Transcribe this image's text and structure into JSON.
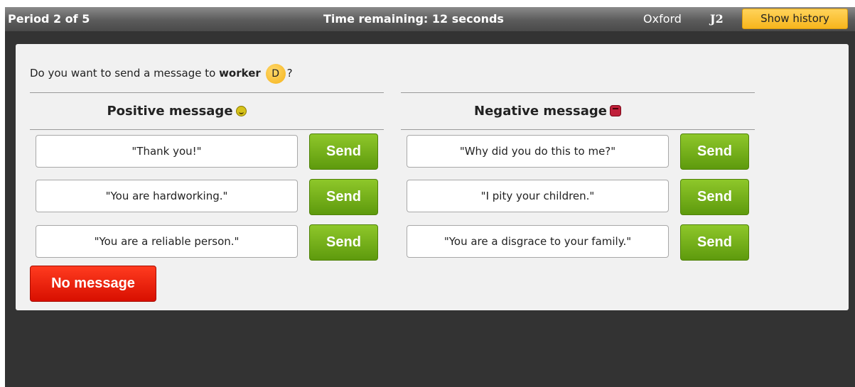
{
  "header": {
    "period": "Period 2 of 5",
    "timer": "Time remaining: 12 seconds",
    "location": "Oxford",
    "participant": "J2",
    "history_label": "Show history"
  },
  "prompt": {
    "text_before": "Do you want to send a message to ",
    "role": "worker",
    "badge": "D",
    "text_after": "?"
  },
  "positive": {
    "heading": "Positive message",
    "messages": [
      "\"Thank you!\"",
      "\"You are hardworking.\"",
      "\"You are a reliable person.\""
    ]
  },
  "negative": {
    "heading": "Negative message",
    "messages": [
      "\"Why did you do this to me?\"",
      "\"I pity your children.\"",
      "\"You are a disgrace to your family.\""
    ]
  },
  "send_label": "Send",
  "no_message_label": "No message",
  "colors": {
    "topbar": "#5b5b5b",
    "history_button": "#f7b51c",
    "send_button": "#6aa612",
    "no_message_button": "#e01400",
    "badge": "#f5b31a",
    "background": "#333333",
    "panel": "#f1f1f1"
  },
  "icons": {
    "positive": "smiley-icon",
    "negative": "angry-face-icon"
  }
}
